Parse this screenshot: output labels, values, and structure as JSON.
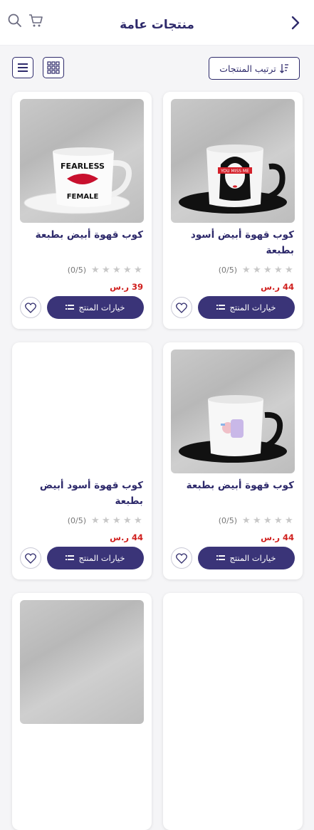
{
  "header": {
    "title": "منتجات عامة"
  },
  "toolbar": {
    "sort_label": "ترتيب المنتجات"
  },
  "products": [
    {
      "name": "كوب قهوة أبيض أسود بطبعة",
      "rating_text": "(0/5)",
      "price": "44 ر.س",
      "options_label": "خيارات المنتج",
      "mug_text": "YOU MISS ME"
    },
    {
      "name": "كوب قهوة أبيض بطبعة",
      "rating_text": "(0/5)",
      "price": "39 ر.س",
      "options_label": "خيارات المنتج",
      "mug_text_1": "FEARLESS",
      "mug_text_2": "FEMALE"
    },
    {
      "name": "كوب قهوة أبيض بطبعة",
      "rating_text": "(0/5)",
      "price": "44 ر.س",
      "options_label": "خيارات المنتج"
    },
    {
      "name": "كوب قهوة أسود أبيض بطبعة",
      "rating_text": "(0/5)",
      "price": "44 ر.س",
      "options_label": "خيارات المنتج"
    }
  ],
  "colors": {
    "primary": "#3a3478",
    "title": "#2e2a6b",
    "price": "#d0201e",
    "star": "#c8c8c8"
  }
}
